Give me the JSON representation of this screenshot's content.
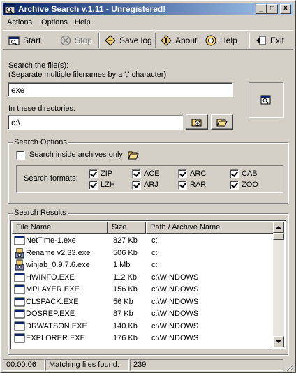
{
  "window": {
    "title": "Archive Search v.1.11 - Unregistered!",
    "minimize": "_",
    "maximize": "□",
    "close": "X"
  },
  "menu": {
    "actions": "Actions",
    "options": "Options",
    "help": "Help"
  },
  "toolbar": {
    "start": "Start",
    "stop": "Stop",
    "save_log": "Save log",
    "about": "About",
    "help": "Help",
    "exit": "Exit"
  },
  "search": {
    "files_label_1": "Search the file(s):",
    "files_label_2": "(Separate multiple filenames by a ';' character)",
    "files_value": "exe",
    "dirs_label": "In these directories:",
    "dirs_value": "c:\\"
  },
  "options": {
    "group_title": "Search Options",
    "inside_archives_label": "Search inside archives only",
    "inside_archives_checked": false,
    "formats_label": "Search formats:",
    "formats": [
      {
        "name": "ZIP",
        "checked": true
      },
      {
        "name": "ACE",
        "checked": true
      },
      {
        "name": "ARC",
        "checked": true
      },
      {
        "name": "CAB",
        "checked": true
      },
      {
        "name": "LZH",
        "checked": true
      },
      {
        "name": "ARJ",
        "checked": true
      },
      {
        "name": "RAR",
        "checked": true
      },
      {
        "name": "ZOO",
        "checked": true
      }
    ]
  },
  "results": {
    "group_title": "Search Results",
    "columns": [
      "File Name",
      "Size",
      "Path / Archive Name"
    ],
    "rows": [
      {
        "name": "NetTime-1.exe",
        "size": "827 Kb",
        "path": "c:",
        "icon": "window-exe-icon"
      },
      {
        "name": "Rename v2.33.exe",
        "size": "506 Kb",
        "path": "c:",
        "icon": "installer-icon"
      },
      {
        "name": "winjab_0.9.7.6.exe",
        "size": "1 Mb",
        "path": "c:",
        "icon": "installer-icon"
      },
      {
        "name": "HWINFO.EXE",
        "size": "112 Kb",
        "path": "c:\\WINDOWS",
        "icon": "window-exe-icon"
      },
      {
        "name": "MPLAYER.EXE",
        "size": "156 Kb",
        "path": "c:\\WINDOWS",
        "icon": "window-exe-icon"
      },
      {
        "name": "CLSPACK.EXE",
        "size": "56 Kb",
        "path": "c:\\WINDOWS",
        "icon": "window-exe-icon"
      },
      {
        "name": "DOSREP.EXE",
        "size": "87 Kb",
        "path": "c:\\WINDOWS",
        "icon": "window-exe-icon"
      },
      {
        "name": "DRWATSON.EXE",
        "size": "140 Kb",
        "path": "c:\\WINDOWS",
        "icon": "window-exe-icon"
      },
      {
        "name": "EXPLORER.EXE",
        "size": "176 Kb",
        "path": "c:\\WINDOWS",
        "icon": "window-exe-icon"
      }
    ]
  },
  "status": {
    "elapsed": "00:00:06",
    "matching_label": "Matching files found:",
    "matching_count": "239"
  }
}
